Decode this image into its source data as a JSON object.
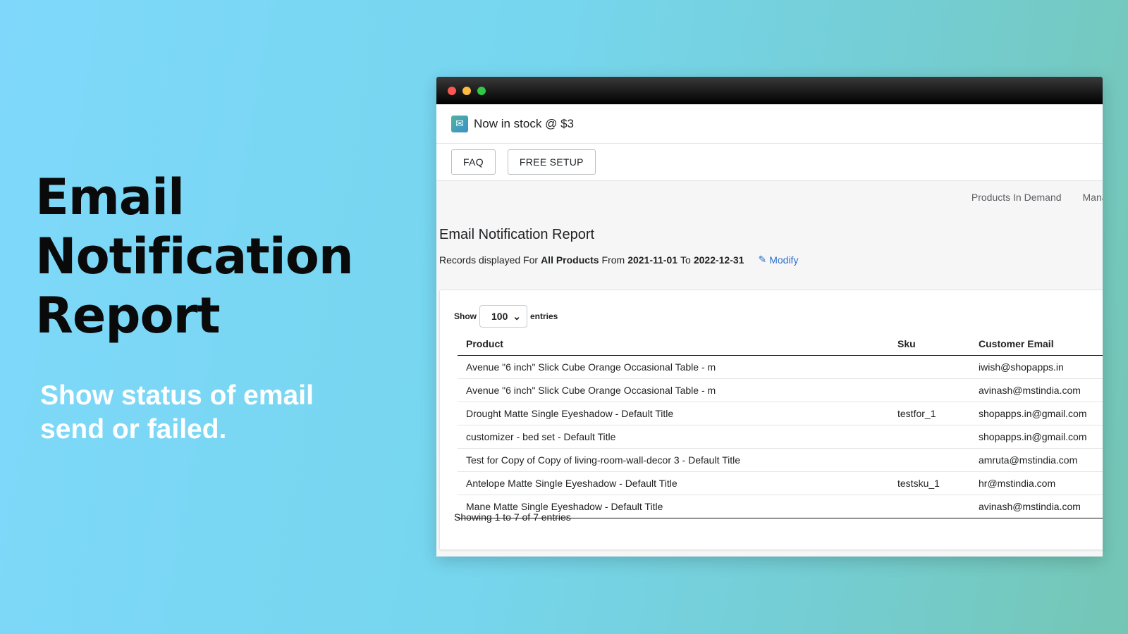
{
  "hero": {
    "title_lines": [
      "Email",
      "Notification",
      "Report"
    ],
    "subtitle": "Show status of email send or failed."
  },
  "app": {
    "name": "Now in stock @ $3",
    "buttons": {
      "faq": "FAQ",
      "free_setup": "FREE SETUP"
    },
    "nav": [
      "Products In Demand",
      "Manage Pr"
    ]
  },
  "report": {
    "title": "Email Notification Report",
    "records_prefix": "Records displayed For",
    "scope": "All Products",
    "from_label": "From",
    "from_date": "2021-11-01",
    "to_label": "To",
    "to_date": "2022-12-31",
    "modify_label": "Modify"
  },
  "table": {
    "show_label": "Show",
    "entries_value": "100",
    "entries_label": "entries",
    "headers": [
      "Product",
      "Sku",
      "Customer Email"
    ],
    "rows": [
      [
        "Avenue \"6 inch\" Slick Cube Orange Occasional Table - m",
        "",
        "iwish@shopapps.in"
      ],
      [
        "Avenue \"6 inch\" Slick Cube Orange Occasional Table - m",
        "",
        "avinash@mstindia.com"
      ],
      [
        "Drought Matte Single Eyeshadow - Default Title",
        "testfor_1",
        "shopapps.in@gmail.com"
      ],
      [
        "customizer - bed set - Default Title",
        "",
        "shopapps.in@gmail.com"
      ],
      [
        "Test for Copy of Copy of living-room-wall-decor 3 - Default Title",
        "",
        "amruta@mstindia.com"
      ],
      [
        "Antelope Matte Single Eyeshadow - Default Title",
        "testsku_1",
        "hr@mstindia.com"
      ],
      [
        "Mane Matte Single Eyeshadow - Default Title",
        "",
        "avinash@mstindia.com"
      ]
    ],
    "footer": "Showing 1 to 7 of 7 entries"
  },
  "colors": {
    "accent_link": "#2c6ecb",
    "traffic_red": "#fc5753",
    "traffic_yellow": "#fdbc40",
    "traffic_green": "#33c748"
  }
}
